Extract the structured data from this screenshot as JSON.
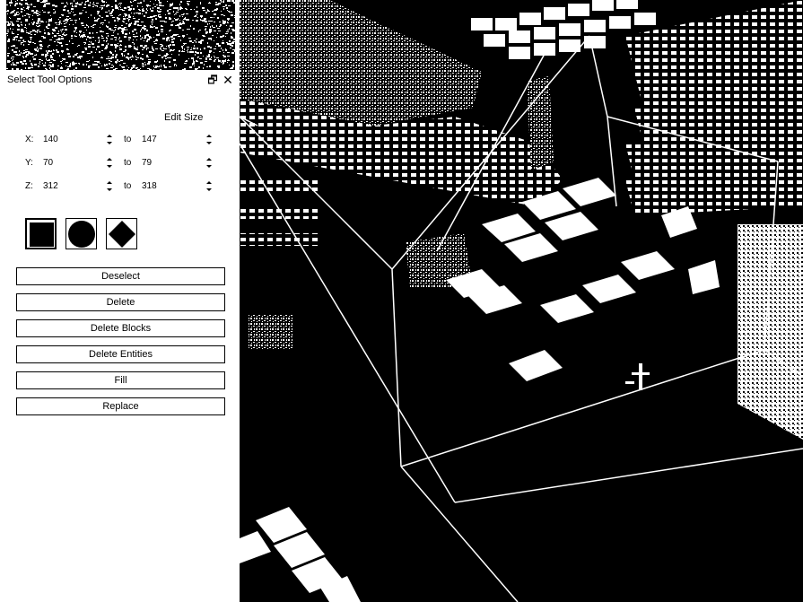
{
  "panel": {
    "title": "Select Tool Options",
    "edit_size_label": "Edit Size",
    "to_label": "to",
    "coords": [
      {
        "axis": "X:",
        "from": "140",
        "to": "147"
      },
      {
        "axis": "Y:",
        "from": "70",
        "to": "79"
      },
      {
        "axis": "Z:",
        "from": "312",
        "to": "318"
      }
    ],
    "shapes": [
      "box-shape-icon",
      "sphere-shape-icon",
      "diamond-shape-icon"
    ],
    "buttons": {
      "deselect": "Deselect",
      "delete": "Delete",
      "delete_blocks": "Delete Blocks",
      "delete_entities": "Delete Entities",
      "fill": "Fill",
      "replace": "Replace"
    }
  },
  "colors": {
    "background": "#000000",
    "foreground": "#ffffff",
    "panel": "#ffffff"
  }
}
